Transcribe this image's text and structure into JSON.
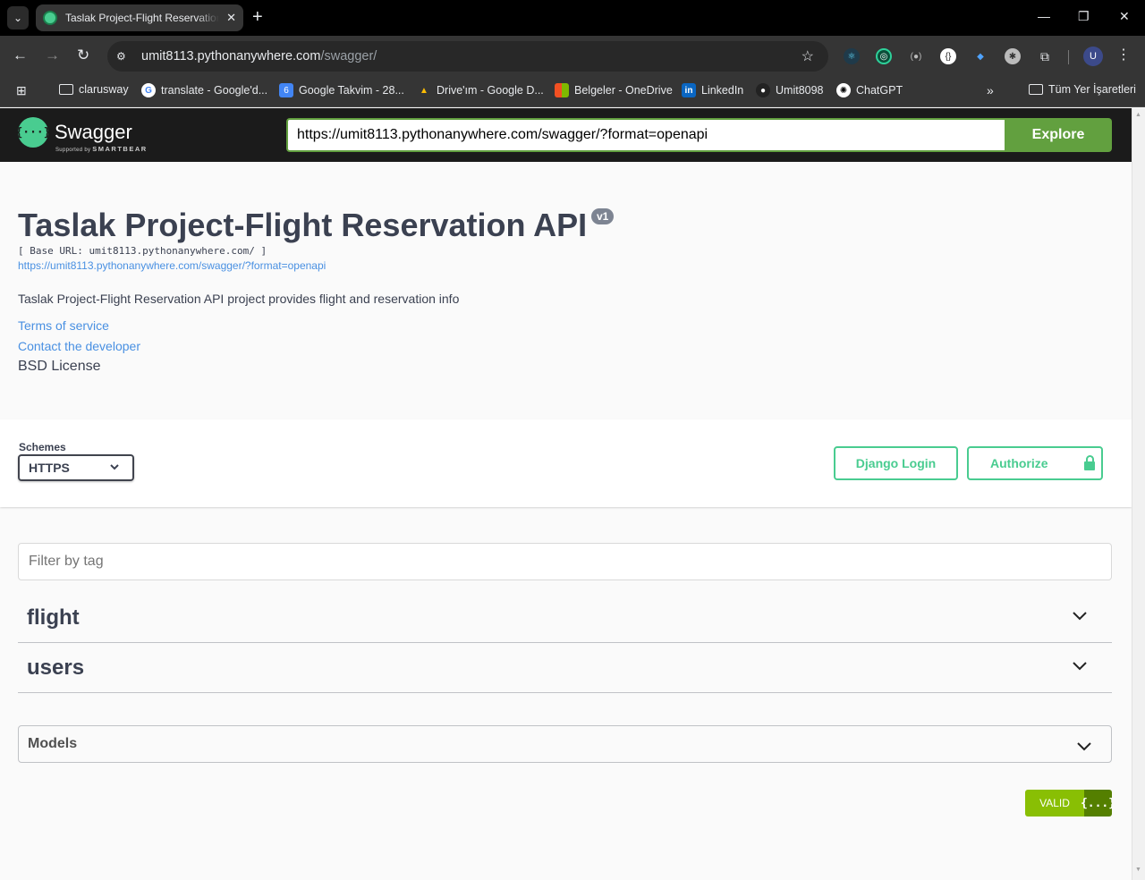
{
  "browser": {
    "tab_title": "Taslak Project-Flight Reservation API",
    "tab_close": "✕",
    "new_tab": "+",
    "window": {
      "minimize": "—",
      "restore": "❐",
      "close": "✕"
    },
    "nav": {
      "back": "←",
      "forward": "→",
      "reload": "↻"
    },
    "address": {
      "host": "umit8113.pythonanywhere.com",
      "path": "/swagger/"
    },
    "profile_initial": "U",
    "bookmarks": [
      {
        "label": "clarusway",
        "icon": "folder-icon"
      },
      {
        "label": "translate - Google'd...",
        "icon": "google-icon"
      },
      {
        "label": "Google Takvim - 28...",
        "icon": "calendar-icon"
      },
      {
        "label": "Drive'ım - Google D...",
        "icon": "drive-icon"
      },
      {
        "label": "Belgeler - OneDrive",
        "icon": "microsoft-icon"
      },
      {
        "label": "LinkedIn",
        "icon": "linkedin-icon"
      },
      {
        "label": "Umit8098",
        "icon": "github-icon"
      },
      {
        "label": "ChatGPT",
        "icon": "chatgpt-icon"
      }
    ],
    "bookmarks_more": "»",
    "all_bookmarks": "Tüm Yer İşaretleri"
  },
  "swagger": {
    "brand": "Swagger",
    "supported_by": "Supported by",
    "smartbear": "SMARTBEAR",
    "url_value": "https://umit8113.pythonanywhere.com/swagger/?format=openapi",
    "explore_label": "Explore"
  },
  "info": {
    "title": "Taslak Project-Flight Reservation API",
    "version": "v1",
    "base_url": "[ Base URL: umit8113.pythonanywhere.com/ ]",
    "spec_link": "https://umit8113.pythonanywhere.com/swagger/?format=openapi",
    "description": "Taslak Project-Flight Reservation API project provides flight and reservation info",
    "terms": "Terms of service",
    "contact": "Contact the developer",
    "license": "BSD License"
  },
  "schemes": {
    "label": "Schemes",
    "selected": "HTTPS",
    "django_login": "Django Login",
    "authorize": "Authorize"
  },
  "filter": {
    "placeholder": "Filter by tag"
  },
  "tags": [
    {
      "name": "flight"
    },
    {
      "name": "users"
    }
  ],
  "models": {
    "label": "Models"
  },
  "validator": {
    "label": "VALID",
    "icon_text": "{...}"
  },
  "colors": {
    "swagger_green": "#49cc90",
    "explore_green": "#62a03f",
    "topbar": "#1b1b1b",
    "text": "#3b4151",
    "link": "#4990e2"
  }
}
